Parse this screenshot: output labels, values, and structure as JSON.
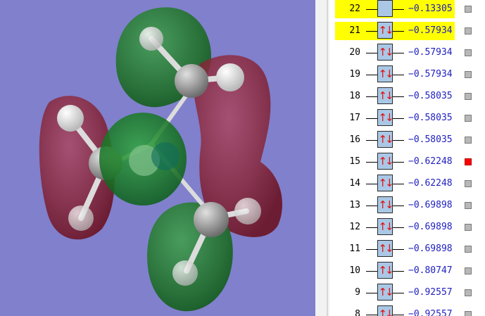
{
  "orbitals": [
    {
      "number": "22",
      "energy": "−0.13305",
      "occupied": false,
      "highlighted": true,
      "flag": "gray"
    },
    {
      "number": "21",
      "energy": "−0.57934",
      "occupied": true,
      "highlighted": true,
      "flag": "gray"
    },
    {
      "number": "20",
      "energy": "−0.57934",
      "occupied": true,
      "highlighted": false,
      "flag": "gray"
    },
    {
      "number": "19",
      "energy": "−0.57934",
      "occupied": true,
      "highlighted": false,
      "flag": "gray"
    },
    {
      "number": "18",
      "energy": "−0.58035",
      "occupied": true,
      "highlighted": false,
      "flag": "gray"
    },
    {
      "number": "17",
      "energy": "−0.58035",
      "occupied": true,
      "highlighted": false,
      "flag": "gray"
    },
    {
      "number": "16",
      "energy": "−0.58035",
      "occupied": true,
      "highlighted": false,
      "flag": "gray"
    },
    {
      "number": "15",
      "energy": "−0.62248",
      "occupied": true,
      "highlighted": false,
      "flag": "red"
    },
    {
      "number": "14",
      "energy": "−0.62248",
      "occupied": true,
      "highlighted": false,
      "flag": "gray"
    },
    {
      "number": "13",
      "energy": "−0.69898",
      "occupied": true,
      "highlighted": false,
      "flag": "gray"
    },
    {
      "number": "12",
      "energy": "−0.69898",
      "occupied": true,
      "highlighted": false,
      "flag": "gray"
    },
    {
      "number": "11",
      "energy": "−0.69898",
      "occupied": true,
      "highlighted": false,
      "flag": "gray"
    },
    {
      "number": "10",
      "energy": "−0.80747",
      "occupied": true,
      "highlighted": false,
      "flag": "gray"
    },
    {
      "number": "9",
      "energy": "−0.92557",
      "occupied": true,
      "highlighted": false,
      "flag": "gray"
    },
    {
      "number": "8",
      "energy": "−0.92557",
      "occupied": true,
      "highlighted": false,
      "flag": "gray"
    }
  ],
  "colors": {
    "viewport_background": "#8080cc",
    "positive_lobe": "#1e7a2e",
    "negative_lobe": "#8a1a2e",
    "highlight": "#ffff00",
    "orbital_box": "#aac8e6",
    "electron_arrows": "#e01010",
    "energy_text": "#2020c0",
    "flag_selected": "#ff0000"
  },
  "electron_symbol": "↑↓"
}
